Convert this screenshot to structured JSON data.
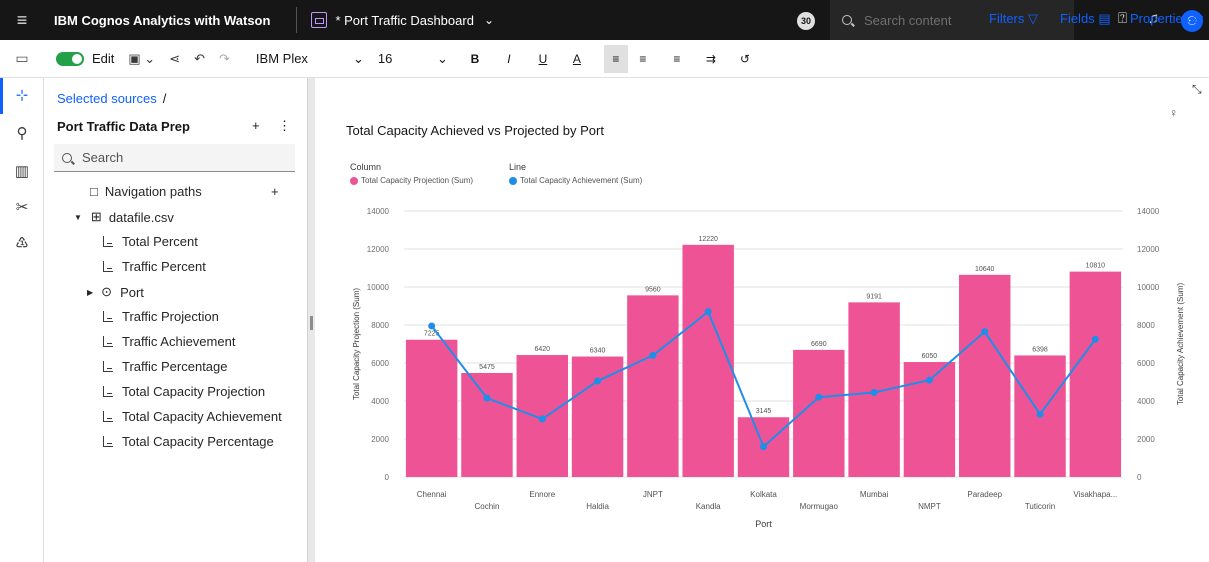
{
  "topbar": {
    "brand": "IBM Cognos Analytics with Watson",
    "dashboard_title": "* Port Traffic Dashboard",
    "notification_count": "30",
    "search_placeholder": "Search content"
  },
  "toolbar": {
    "edit_label": "Edit",
    "font": "IBM Plex",
    "font_size": "16",
    "bold": "B",
    "italic": "I",
    "underline": "U",
    "text_color": "A",
    "filters_label": "Filters",
    "fields_label": "Fields",
    "properties_label": "Properties"
  },
  "sidebar": {
    "breadcrumb": "Selected sources",
    "breadcrumb_sep": "/",
    "source_title": "Port Traffic Data Prep",
    "add_label": "+",
    "more_label": "⋮",
    "search_placeholder": "Search",
    "navigation_paths": "Navigation paths",
    "file_name": "datafile.csv",
    "fields": [
      "Total Percent",
      "Traffic Percent",
      "Port",
      "Traffic Projection",
      "Traffic Achievement",
      "Traffic Percentage",
      "Total Capacity Projection",
      "Total Capacity Achievement",
      "Total Capacity Percentage"
    ]
  },
  "colors": {
    "bar": "#ee5396",
    "line": "#1f8ee8",
    "accent": "#0f62fe"
  },
  "chart_data": {
    "type": "bar",
    "title": "Total Capacity Achieved vs Projected by Port",
    "legend": {
      "column_heading": "Column",
      "line_heading": "Line",
      "placement": "top-left"
    },
    "categories": [
      "Chennai",
      "Cochin",
      "Ennore",
      "Haldia",
      "JNPT",
      "Kandla",
      "Kolkata",
      "Mormugao",
      "Mumbai",
      "NMPT",
      "Paradeep",
      "Tuticorin",
      "Visakhapa..."
    ],
    "series": [
      {
        "name": "Total Capacity Projection (Sum)",
        "type": "bar",
        "axis": "left",
        "values": [
          7225,
          5475,
          6420,
          6340,
          9560,
          12220,
          3145,
          6690,
          9191,
          6050,
          10640,
          6398,
          10810
        ]
      },
      {
        "name": "Total Capacity Achievement (Sum)",
        "type": "line",
        "axis": "right",
        "values": [
          7950,
          4150,
          3050,
          5050,
          6400,
          8700,
          1600,
          4200,
          4450,
          5100,
          7650,
          3300,
          7250
        ]
      }
    ],
    "bar_labels": [
      "7225",
      "5475",
      "6420",
      "6340",
      "9560",
      "12220",
      "3145",
      "6690",
      "9191",
      "6050",
      "10640",
      "6398",
      "10810"
    ],
    "xlabel": "Port",
    "ylabel": "Total Capacity Projection (Sum)",
    "ylabel_right": "Total Capacity Achievement (Sum)",
    "ylim": [
      0,
      14000
    ],
    "yticks": [
      "0",
      "2000",
      "4000",
      "6000",
      "8000",
      "10000",
      "12000",
      "14000"
    ],
    "grid": true
  }
}
